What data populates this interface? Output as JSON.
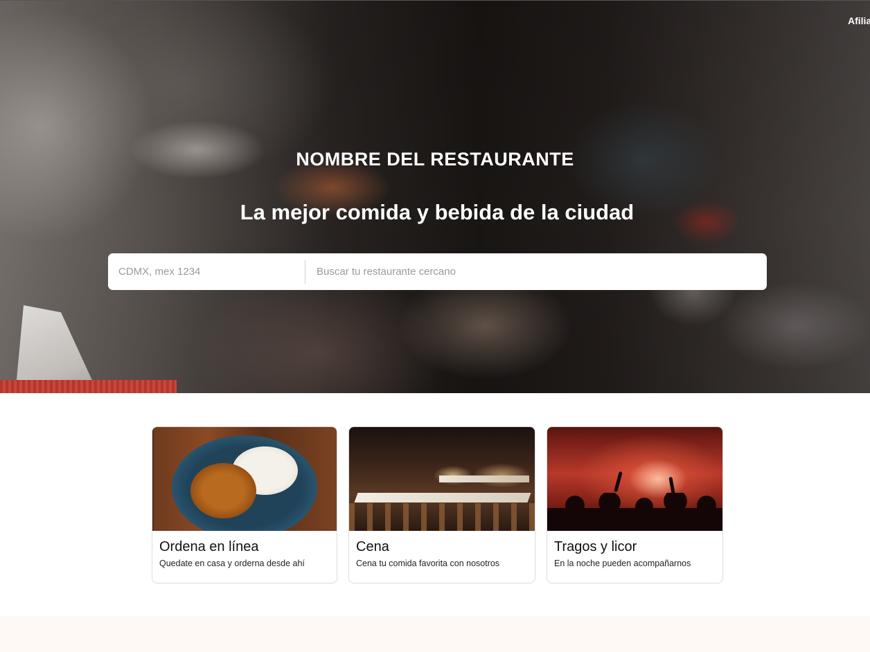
{
  "nav": {
    "link_label": "Afilia"
  },
  "hero": {
    "title": "NOMBRE DEL RESTAURANTE",
    "subtitle": "La mejor comida y bebida de la ciudad",
    "search": {
      "location_placeholder": "CDMX, mex 1234",
      "query_placeholder": "Buscar tu restaurante cercano"
    }
  },
  "cards": [
    {
      "title": "Ordena en línea",
      "description": "Quedate en casa y orderna desde ahí",
      "image": "plate-of-food-image"
    },
    {
      "title": "Cena",
      "description": "Cena tu comida favorita con nosotros",
      "image": "dining-room-image"
    },
    {
      "title": "Tragos y licor",
      "description": "En la noche pueden acompañarnos",
      "image": "concert-crowd-image"
    }
  ],
  "colors": {
    "accent_background": "#fef9f5",
    "text_dark": "#111111",
    "placeholder": "#9a9a9a"
  }
}
